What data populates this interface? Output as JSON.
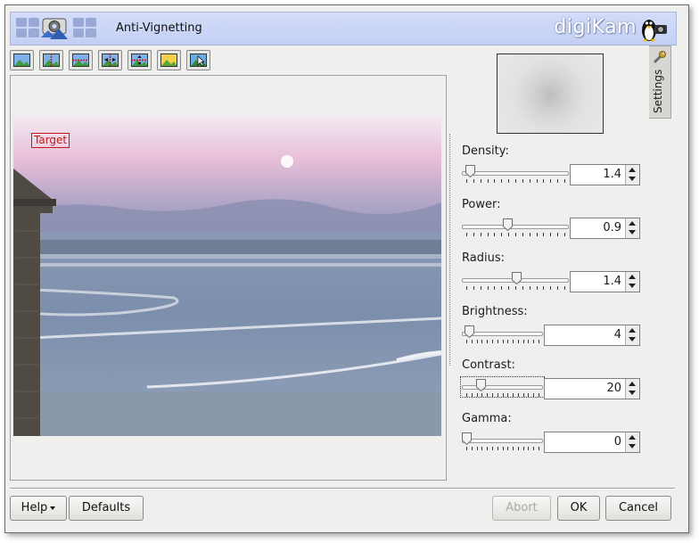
{
  "banner": {
    "title": "Anti-Vignetting",
    "brand": "digiKam"
  },
  "toolbar": {
    "buttons": [
      {
        "icon": "original-image-icon"
      },
      {
        "icon": "split-vertical-icon"
      },
      {
        "icon": "split-horizontal-icon"
      },
      {
        "icon": "split-vertical-dual-icon"
      },
      {
        "icon": "split-horizontal-dual-icon"
      },
      {
        "icon": "target-image-icon"
      },
      {
        "icon": "over-under-exposure-icon"
      }
    ]
  },
  "preview": {
    "target_label": "Target"
  },
  "side_tab": {
    "label": "Settings"
  },
  "settings": {
    "density": {
      "label": "Density:",
      "value": "1.4",
      "level": 0.04
    },
    "power": {
      "label": "Power:",
      "value": "0.9",
      "level": 0.43
    },
    "radius": {
      "label": "Radius:",
      "value": "1.4",
      "level": 0.52
    },
    "brightness": {
      "label": "Brightness:",
      "value": "4",
      "level": 0.04
    },
    "contrast": {
      "label": "Contrast:",
      "value": "20",
      "level": 0.2
    },
    "gamma": {
      "label": "Gamma:",
      "value": "0",
      "level": 0.0
    }
  },
  "buttons": {
    "help": "Help",
    "defaults": "Defaults",
    "abort": "Abort",
    "ok": "OK",
    "cancel": "Cancel"
  },
  "colors": {
    "banner": "#c4cff4",
    "target_frame": "#c21a1a"
  }
}
